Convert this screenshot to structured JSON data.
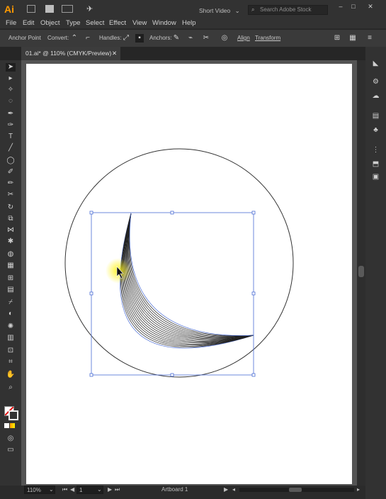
{
  "app": {
    "logo": "Ai"
  },
  "titlebar": {
    "workspace": "Short Video",
    "search_placeholder": "Search Adobe Stock",
    "win_controls": [
      "–",
      "□",
      "✕"
    ]
  },
  "menu": {
    "items": [
      "File",
      "Edit",
      "Object",
      "Type",
      "Select",
      "Effect",
      "View",
      "Window",
      "Help"
    ]
  },
  "control_bar": {
    "anchor_point": "Anchor Point",
    "convert": "Convert:",
    "handles": "Handles:",
    "anchors": "Anchors:",
    "align": "Align",
    "transform": "Transform"
  },
  "tab": {
    "title": "01.ai* @ 110% (CMYK/Preview)",
    "close": "✕"
  },
  "status": {
    "zoom": "110%",
    "artboard_num": "1",
    "artboard_label": "Artboard 1"
  },
  "colors": {
    "accent": "#ff9a00",
    "selection": "#4a6cd4",
    "highlight": "#fff200"
  },
  "icons": {
    "tools": [
      "selection-tool-icon",
      "direct-selection-tool-icon",
      "magic-wand-icon",
      "lasso-icon",
      "pen-tool-icon",
      "curvature-tool-icon",
      "type-tool-icon",
      "line-tool-icon",
      "ellipse-tool-icon",
      "paintbrush-icon",
      "blob-brush-icon",
      "scissors-icon",
      "rotate-tool-icon",
      "scale-tool-icon",
      "width-tool-icon",
      "puppet-warp-icon",
      "shape-builder-icon",
      "perspective-grid-icon",
      "mesh-tool-icon",
      "gradient-tool-icon",
      "eyedropper-icon",
      "blend-tool-icon",
      "symbol-sprayer-icon",
      "graph-tool-icon",
      "artboard-tool-icon",
      "slice-tool-icon",
      "hand-tool-icon",
      "zoom-tool-icon"
    ],
    "panels": [
      "properties-icon",
      "libraries-icon",
      "cc-libraries-icon",
      "swatches-icon",
      "brushes-icon",
      "symbols-icon",
      "transform-panel-icon",
      "align-panel-icon",
      "pathfinder-icon"
    ]
  }
}
